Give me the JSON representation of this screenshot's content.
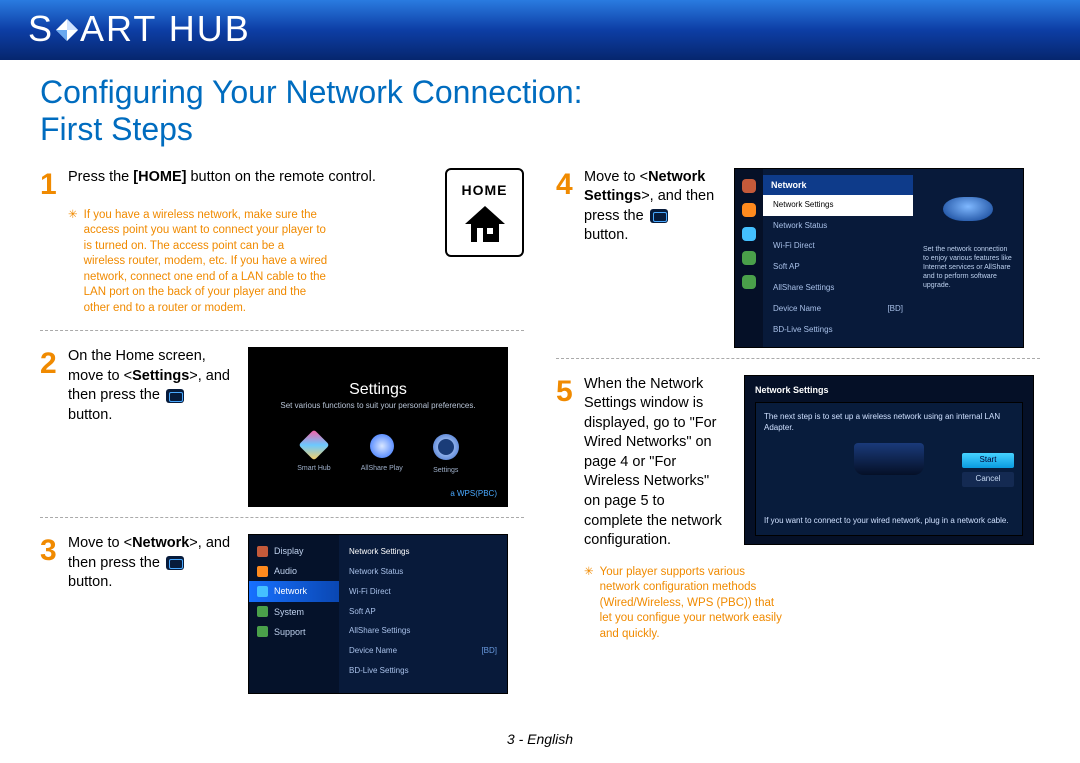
{
  "brand": {
    "prefix": "S",
    "mid": "ART",
    "suffix": "HUB"
  },
  "title": "Configuring Your Network Connection:\nFirst Steps",
  "footer": "3 - English",
  "steps": {
    "s1": {
      "num": "1",
      "text_a": "Press the ",
      "text_b": "[HOME]",
      "text_c": " button on the remote control.",
      "note": "If you have a wireless network, make sure the access point you want to connect your player to is turned on. The access point can be a wireless router, modem, etc. If you have a wired network, connect one end of a LAN cable to the LAN port on the back of your player and the other end to a router or modem.",
      "home_label": "HOME"
    },
    "s2": {
      "num": "2",
      "text_a": "On the Home screen, move to <",
      "text_b": "Settings",
      "text_c": ">, and then press the ",
      "text_d": " button."
    },
    "s3": {
      "num": "3",
      "text_a": "Move to <",
      "text_b": "Network",
      "text_c": ">, and then press the ",
      "text_d": " button."
    },
    "s4": {
      "num": "4",
      "text_a": "Move to <",
      "text_b": "Network Settings",
      "text_c": ">, and then press the ",
      "text_d": " button."
    },
    "s5": {
      "num": "5",
      "text": "When the Network Settings window is displayed, go to \"For Wired Networks\" on page 4 or \"For Wireless Networks\" on page 5 to complete the network configuration.",
      "note": "Your player supports various network configuration methods (Wired/Wireless, WPS (PBC)) that let you configue your network easily and quickly."
    }
  },
  "settings_shot": {
    "title": "Settings",
    "sub": "Set various functions to suit your personal preferences.",
    "apps": [
      "Smart Hub",
      "AllShare Play",
      "Settings"
    ],
    "tag": "a  WPS(PBC)"
  },
  "net_menu": {
    "left": [
      "Display",
      "Audio",
      "Network",
      "System",
      "Support"
    ],
    "right": [
      "Network Settings",
      "Network Status",
      "Wi-Fi Direct",
      "Soft AP",
      "AllShare Settings",
      "Device Name",
      "BD-Live Settings"
    ],
    "bd": "[BD]"
  },
  "ns_shot": {
    "header": "Network",
    "items": [
      "Network Settings",
      "Network Status",
      "Wi-Fi Direct",
      "Soft AP",
      "AllShare Settings",
      "Device Name",
      "BD-Live Settings"
    ],
    "bd": "[BD]",
    "desc": "Set the network connection to enjoy various features like Internet services or AllShare and to perform software upgrade."
  },
  "wiz": {
    "header": "Network Settings",
    "line1": "The next step is to set up a wireless network using an internal LAN Adapter.",
    "line2": "If you want to connect to your wired network, plug in a network cable.",
    "start": "Start",
    "cancel": "Cancel"
  }
}
